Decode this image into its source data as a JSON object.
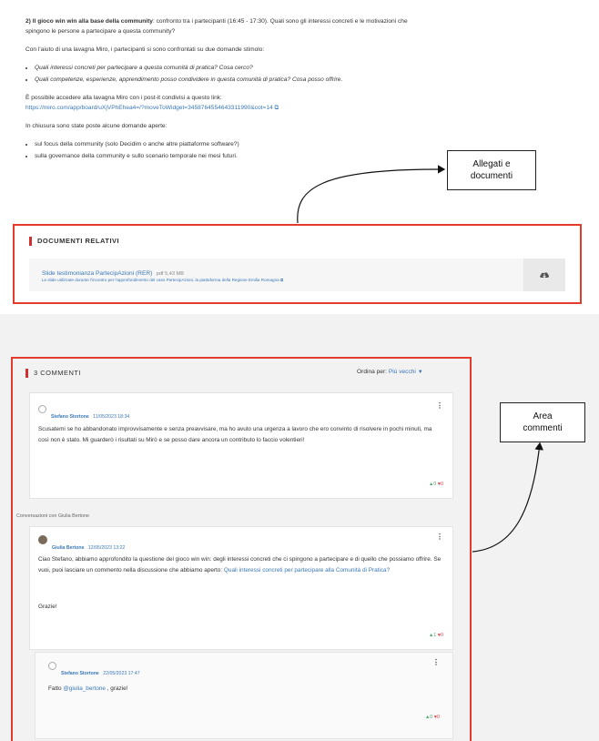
{
  "article": {
    "p1_strong": "2) Il gioco win win alla base della community",
    "p1_rest": ": confronto tra i partecipanti (16:45 - 17:30). Quali sono gli interessi concreti e le motivazioni che spingono le persone a partecipare a questa community?",
    "p2": "Con l'aiuto di una lavagna Miro, i partecipanti si sono confrontati su due domande stimolo:",
    "q1": "Quali interessi concreti per partecipare a questa comunità di pratica? Cosa cerco?",
    "q2": "Quali competenze, esperienze, apprendimento posso condividere in questa comunità di pratica? Cosa posso offrire.",
    "p3": "È possibile accedere alla lavagna Miro con i post-it condivisi a questo link:",
    "miro_link": "https://miro.com/app/board/uXjVPhEhea4=/?moveToWidget=3458764554643311990&cot=14 ⧉",
    "p4": "In chiusura sono state poste alcune domande aperte:",
    "b1": "sul focus della community (solo Decidim o anche altre piattaforme software?)",
    "b2": "sulla governance della community e sullo scenario temporale nei mesi futuri."
  },
  "docs": {
    "title": "DOCUMENTI RELATIVI",
    "link": "Slide testimonianza PartecipAzioni (RER)",
    "meta": "pdf 5,43 MB",
    "desc": "Le slide utilizzate durante l'incontro per l'approfondimento del caso PartecipAzioni, la piattaforma della Regione Emilia Romagna ⧉",
    "download_icon": "download-cloud-icon"
  },
  "comments": {
    "title": "3 COMMENTI",
    "sort_label": "Ordina per:",
    "sort_value": "Più vecchi",
    "conversation_label": "Conversazioni con Giulia Bertone",
    "items": [
      {
        "author": "Stefano Stortone",
        "date": "11/05/2023 18:34",
        "text": "Scusatemi se ho abbandonato improvvisamente e senza preavvisare, ma ho avuto una urgenza a lavoro che ero convinto di risolvere in pochi minuti, ma così non è stato. Mi guarderò i risultati su Mirò e se posso dare ancora un contributo lo faccio volentieri!",
        "up": "0",
        "down": "0"
      },
      {
        "author": "Giulia Bertone",
        "date": "12/05/2023 13:22",
        "text": "Ciao Stefano, abbiamo approfondito la questione del gioco win win: degli interessi concreti che ci spingono a partecipare e di quello che possiamo offrire. Se vuoi, puoi lasciare un commento nella discussione che abbiamo aperto: ",
        "link": "Quali interessi concreti per partecipare alla Comunità di Pratica?",
        "closing": "Grazie!",
        "up": "1",
        "down": "0"
      },
      {
        "author": "Stefano Stortone",
        "date": "22/05/2023 17:47",
        "text_prefix": "Fatto ",
        "mention": "@giulia_bertone",
        "text_suffix": " , grazie!",
        "up": "0",
        "down": "0"
      }
    ]
  },
  "callouts": {
    "attachments": "Allegati e documenti",
    "comments_area": "Area commenti"
  },
  "colors": {
    "highlight": "#e53b2c",
    "link": "#3a78b8",
    "accent": "#d0312d"
  }
}
